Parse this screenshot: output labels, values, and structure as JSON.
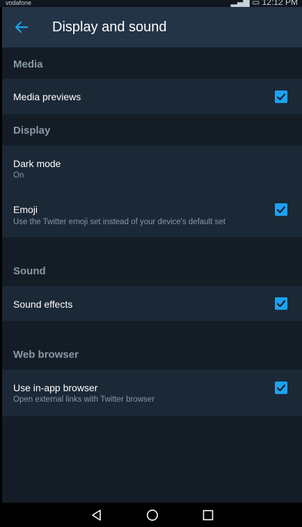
{
  "status_bar": {
    "carrier": "vodafone",
    "time": "12:12 PM"
  },
  "app_bar": {
    "title": "Display and sound"
  },
  "sections": {
    "media": {
      "header": "Media",
      "media_previews": {
        "title": "Media previews",
        "checked": true
      }
    },
    "display": {
      "header": "Display",
      "dark_mode": {
        "title": "Dark mode",
        "subtitle": "On"
      },
      "emoji": {
        "title": "Emoji",
        "subtitle": "Use the Twitter emoji set instead of your device's default set",
        "checked": true
      }
    },
    "sound": {
      "header": "Sound",
      "sound_effects": {
        "title": "Sound effects",
        "checked": true
      }
    },
    "web_browser": {
      "header": "Web browser",
      "in_app_browser": {
        "title": "Use in-app browser",
        "subtitle": "Open external links with Twitter browser",
        "checked": true
      }
    }
  },
  "colors": {
    "accent": "#1da1f2",
    "background": "#141d26",
    "row_background": "#1b2836",
    "app_bar": "#243447",
    "secondary_text": "#8899a6"
  }
}
